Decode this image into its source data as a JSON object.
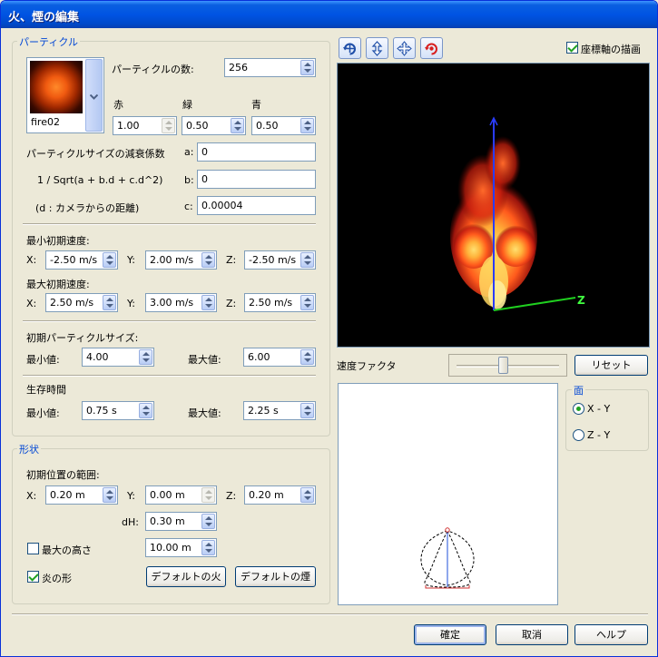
{
  "window": {
    "title": "火、煙の編集"
  },
  "particle_group": {
    "label": "パーティクル",
    "texture_name": "fire02",
    "count_label": "パーティクルの数:",
    "count_value": "256",
    "red_label": "赤",
    "green_label": "緑",
    "blue_label": "青",
    "red_value": "1.00",
    "green_value": "0.50",
    "blue_value": "0.50",
    "attenuation_label": "パーティクルサイズの減衰係数",
    "formula_label": "1 / Sqrt(a + b.d + c.d^2)",
    "distance_label": "(d : カメラからの距離)",
    "a_label": "a:",
    "b_label": "b:",
    "c_label": "c:",
    "a_value": "0",
    "b_value": "0",
    "c_value": "0.00004",
    "min_speed_label": "最小初期速度:",
    "max_speed_label": "最大初期速度:",
    "x_label": "X:",
    "y_label": "Y:",
    "z_label": "Z:",
    "min_speed": {
      "x": "-2.50 m/s",
      "y": "2.00 m/s",
      "z": "-2.50 m/s"
    },
    "max_speed": {
      "x": "2.50 m/s",
      "y": "3.00 m/s",
      "z": "2.50 m/s"
    },
    "size_label": "初期パーティクルサイズ:",
    "min_label": "最小値:",
    "max_label": "最大値:",
    "size_min": "4.00",
    "size_max": "6.00",
    "life_label": "生存時間",
    "life_min": "0.75 s",
    "life_max": "2.25 s"
  },
  "shape_group": {
    "label": "形状",
    "range_label": "初期位置の範囲:",
    "x_label": "X:",
    "y_label": "Y:",
    "z_label": "Z:",
    "x_value": "0.20 m",
    "y_value": "0.00 m",
    "z_value": "0.20 m",
    "dh_label": "dH:",
    "dh_value": "0.30 m",
    "max_height_label": "最大の高さ",
    "max_height_value": "10.00 m",
    "flame_shape_label": "炎の形",
    "default_fire_button": "デフォルトの火",
    "default_smoke_button": "デフォルトの煙"
  },
  "preview": {
    "toolbar_icons": [
      "rotate-icon",
      "move-vertical-icon",
      "move-cross-icon",
      "rotate-red-icon"
    ],
    "draw_axes_label": "座標軸の描画",
    "axis_z_label": "Z",
    "speed_factor_label": "速度ファクタ",
    "speed_factor_level": 0.45,
    "reset_button": "リセット"
  },
  "plane_group": {
    "label": "面",
    "xy_label": "X - Y",
    "zy_label": "Z - Y"
  },
  "footer": {
    "ok_button": "確定",
    "cancel_button": "取消",
    "help_button": "ヘルプ"
  }
}
